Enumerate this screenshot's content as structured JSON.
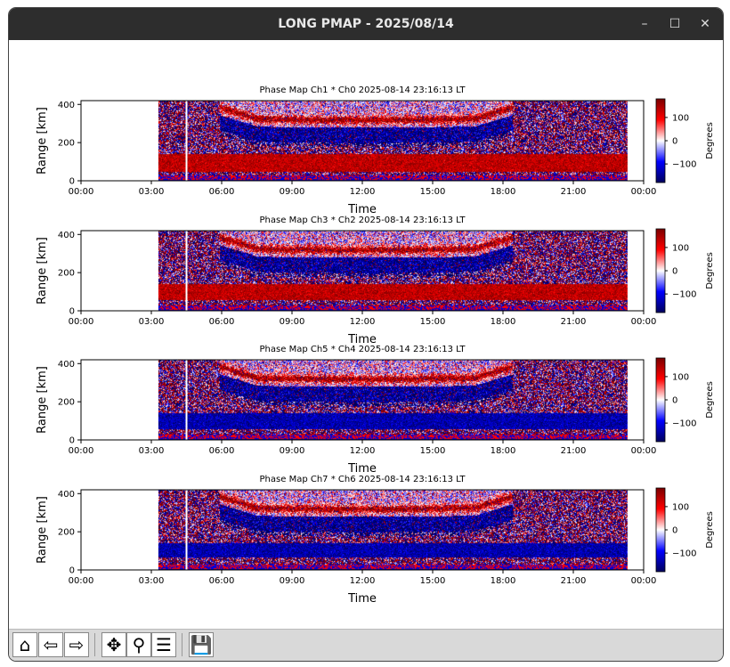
{
  "window": {
    "title": "LONG PMAP - 2025/08/14",
    "minimize_icon": "minimize-icon",
    "maximize_icon": "maximize-icon",
    "close_icon": "close-icon"
  },
  "toolbar": {
    "buttons": [
      {
        "name": "home-button",
        "icon": "home-icon",
        "glyph": "⌂"
      },
      {
        "name": "back-button",
        "icon": "back-arrow-icon",
        "glyph": "⇦"
      },
      {
        "name": "forward-button",
        "icon": "forward-arrow-icon",
        "glyph": "⇨"
      },
      {
        "name": "pan-button",
        "icon": "move-icon",
        "glyph": "✥"
      },
      {
        "name": "zoom-button",
        "icon": "magnifier-icon",
        "glyph": "⚲"
      },
      {
        "name": "configure-button",
        "icon": "sliders-icon",
        "glyph": "☰"
      },
      {
        "name": "save-button",
        "icon": "floppy-disk-icon",
        "glyph": "💾"
      }
    ]
  },
  "colors": {
    "colormap": [
      "#00005c",
      "#0000ff",
      "#ffffff",
      "#ff0000",
      "#7a0000"
    ]
  },
  "chart_data": [
    {
      "type": "heatmap",
      "title": "Phase Map Ch1 * Ch0 2025-08-14 23:16:13 LT",
      "xlabel": "Time",
      "ylabel": "Range [km]",
      "colorbar_label": "Degrees",
      "xticks": [
        "00:00",
        "03:00",
        "06:00",
        "09:00",
        "12:00",
        "15:00",
        "18:00",
        "21:00",
        "00:00"
      ],
      "yticks": [
        "0",
        "200",
        "400"
      ],
      "cticks": [
        "100",
        "0",
        "−100"
      ],
      "xlim_hours": [
        0,
        24
      ],
      "ylim_km": [
        0,
        420
      ],
      "clim_deg": [
        -180,
        180
      ],
      "data_start_hour": 3.3,
      "data_end_hour": 23.3,
      "gap_line_hour": 4.5,
      "low_band_km": [
        50,
        140
      ],
      "low_band_sign": "positive"
    },
    {
      "type": "heatmap",
      "title": "Phase Map Ch3 * Ch2 2025-08-14 23:16:13 LT",
      "xlabel": "Time",
      "ylabel": "Range [km]",
      "colorbar_label": "Degrees",
      "xticks": [
        "00:00",
        "03:00",
        "06:00",
        "09:00",
        "12:00",
        "15:00",
        "18:00",
        "21:00",
        "00:00"
      ],
      "yticks": [
        "0",
        "200",
        "400"
      ],
      "cticks": [
        "100",
        "0",
        "−100"
      ],
      "xlim_hours": [
        0,
        24
      ],
      "ylim_km": [
        0,
        420
      ],
      "clim_deg": [
        -180,
        180
      ],
      "data_start_hour": 3.3,
      "data_end_hour": 23.3,
      "gap_line_hour": 4.5,
      "low_band_km": [
        60,
        140
      ],
      "low_band_sign": "positive"
    },
    {
      "type": "heatmap",
      "title": "Phase Map Ch5 * Ch4 2025-08-14 23:16:13 LT",
      "xlabel": "Time",
      "ylabel": "Range [km]",
      "colorbar_label": "Degrees",
      "xticks": [
        "00:00",
        "03:00",
        "06:00",
        "09:00",
        "12:00",
        "15:00",
        "18:00",
        "21:00",
        "00:00"
      ],
      "yticks": [
        "0",
        "200",
        "400"
      ],
      "cticks": [
        "100",
        "0",
        "−100"
      ],
      "xlim_hours": [
        0,
        24
      ],
      "ylim_km": [
        0,
        420
      ],
      "clim_deg": [
        -180,
        180
      ],
      "data_start_hour": 3.3,
      "data_end_hour": 23.3,
      "gap_line_hour": 4.5,
      "low_band_km": [
        60,
        140
      ],
      "low_band_sign": "negative"
    },
    {
      "type": "heatmap",
      "title": "Phase Map Ch7 * Ch6 2025-08-14 23:16:13 LT",
      "xlabel": "Time",
      "ylabel": "Range [km]",
      "colorbar_label": "Degrees",
      "xticks": [
        "00:00",
        "03:00",
        "06:00",
        "09:00",
        "12:00",
        "15:00",
        "18:00",
        "21:00",
        "00:00"
      ],
      "yticks": [
        "0",
        "200",
        "400"
      ],
      "cticks": [
        "100",
        "0",
        "−100"
      ],
      "xlim_hours": [
        0,
        24
      ],
      "ylim_km": [
        0,
        420
      ],
      "clim_deg": [
        -180,
        180
      ],
      "data_start_hour": 3.3,
      "data_end_hour": 23.3,
      "gap_line_hour": 4.5,
      "low_band_km": [
        70,
        140
      ],
      "low_band_sign": "negative"
    }
  ]
}
